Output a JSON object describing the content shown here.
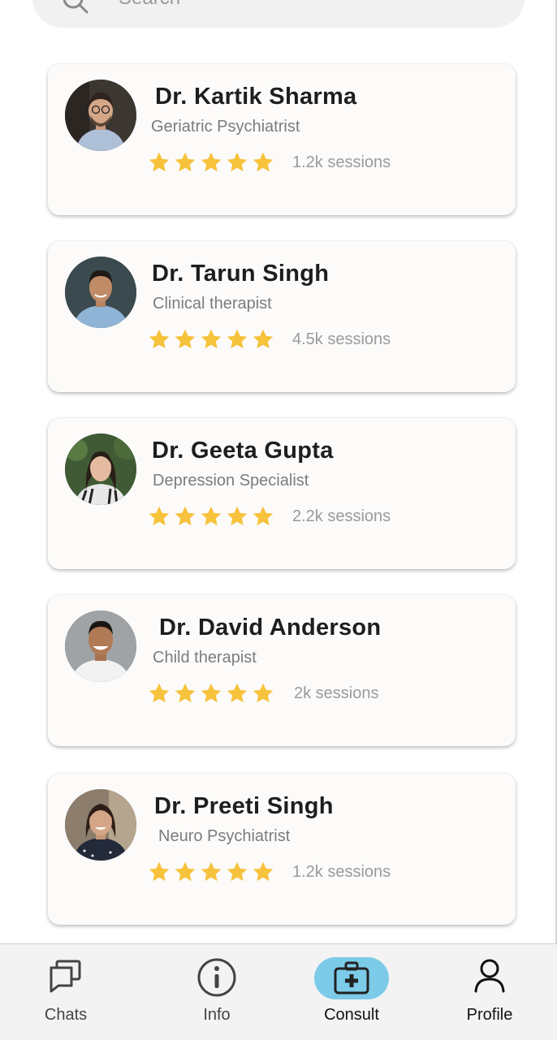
{
  "search": {
    "placeholder": "Search"
  },
  "doctors": [
    {
      "name": "Dr. Kartik Sharma",
      "specialty": "Geriatric Psychiatrist",
      "rating": 5,
      "sessions": "1.2k sessions"
    },
    {
      "name": "Dr. Tarun Singh",
      "specialty": "Clinical therapist",
      "rating": 5,
      "sessions": "4.5k sessions"
    },
    {
      "name": "Dr. Geeta Gupta",
      "specialty": "Depression Specialist",
      "rating": 5,
      "sessions": "2.2k sessions"
    },
    {
      "name": "Dr. David Anderson",
      "specialty": "Child therapist",
      "rating": 5,
      "sessions": "2k sessions"
    },
    {
      "name": "Dr. Preeti Singh",
      "specialty": "Neuro Psychiatrist",
      "rating": 5,
      "sessions": "1.2k sessions"
    }
  ],
  "nav": {
    "items": [
      {
        "label": "Chats",
        "icon": "chats-icon"
      },
      {
        "label": "Info",
        "icon": "info-icon"
      },
      {
        "label": "Consult",
        "icon": "medical-kit-icon"
      },
      {
        "label": "Profile",
        "icon": "profile-icon"
      }
    ],
    "active": "Consult"
  },
  "colors": {
    "star": "#f7c23c",
    "consult_pill": "#7ccbe8",
    "card_bg": "#fcfbfa",
    "nav_bg": "#f3f3f3"
  }
}
